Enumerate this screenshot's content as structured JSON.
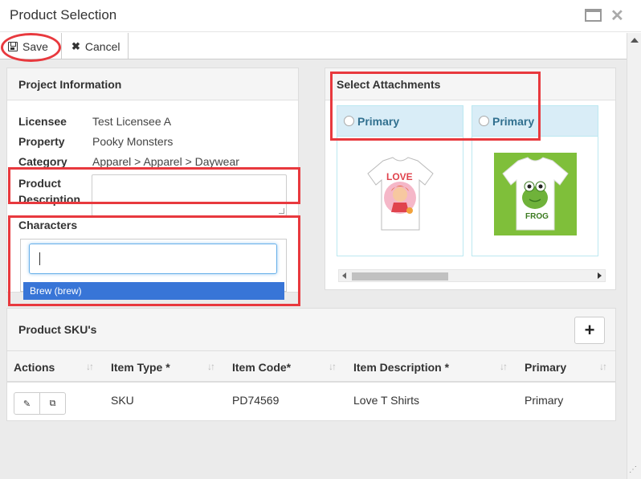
{
  "window": {
    "title": "Product Selection"
  },
  "toolbar": {
    "save_label": "Save",
    "cancel_label": "Cancel"
  },
  "project": {
    "heading": "Project Information",
    "licensee_label": "Licensee",
    "licensee_value": "Test Licensee A",
    "property_label": "Property",
    "property_value": "Pooky Monsters",
    "category_label": "Category",
    "category_value": "Apparel > Apparel > Daywear",
    "desc_label_1": "Product",
    "desc_label_2": "Description",
    "characters_label": "Characters",
    "characters_input_value": "",
    "dropdown_option": "Brew (brew)"
  },
  "attachments": {
    "heading": "Select Attachments",
    "cards": [
      {
        "label": "Primary",
        "image": "love-tshirt-image"
      },
      {
        "label": "Primary",
        "image": "frog-tshirt-image"
      }
    ]
  },
  "sku": {
    "heading": "Product SKU's",
    "add_label": "+",
    "columns": [
      "Actions",
      "Item Type *",
      "Item Code*",
      "Item Description *",
      "Primary"
    ],
    "rows": [
      {
        "item_type": "SKU",
        "item_code": "PD74569",
        "item_description": "Love T Shirts",
        "primary": "Primary"
      }
    ]
  },
  "colors": {
    "highlight": "#e8393e",
    "selected_option": "#3875d7",
    "card_header": "#d9edf7"
  }
}
